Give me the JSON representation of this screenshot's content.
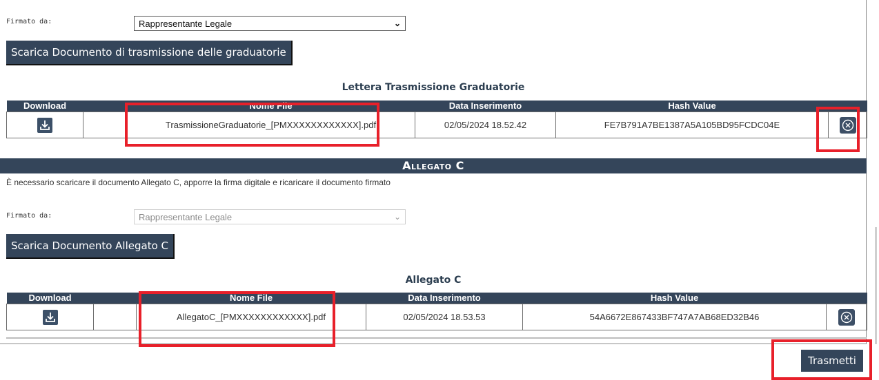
{
  "section1": {
    "signed_by_label": "Firmato da:",
    "signed_by_value": "Rappresentante Legale",
    "download_button": "Scarica Documento di trasmissione delle graduatorie",
    "table_title": "Lettera Trasmissione Graduatorie",
    "headers": [
      "Download",
      "Nome File",
      "Data Inserimento",
      "Hash Value"
    ],
    "row": {
      "file_name": "TrasmissioneGraduatorie_[PMXXXXXXXXXXXX].pdf",
      "date": "02/05/2024 18.52.42",
      "hash": "FE7B791A7BE1387A5A105BD95FCDC04E"
    }
  },
  "section2": {
    "title": "Allegato C",
    "info": "È necessario scaricare il documento Allegato C, apporre la firma digitale e ricaricare il documento firmato",
    "signed_by_label": "Firmato da:",
    "signed_by_value": "Rappresentante Legale",
    "download_button": "Scarica Documento Allegato C",
    "table_title": "Allegato C",
    "headers": [
      "Download",
      "Nome File",
      "Data Inserimento",
      "Hash Value"
    ],
    "row": {
      "file_name": "AllegatoC_[PMXXXXXXXXXXXX].pdf",
      "date": "02/05/2024 18.53.53",
      "hash": "54A6672E867433BF747A7AB68ED32B46"
    }
  },
  "submit_button": "Trasmetti",
  "icons": {
    "download": "download-icon",
    "remove": "remove-circle-x-icon",
    "dropdown": "chevron-down-icon"
  },
  "colors": {
    "header_bg": "#34455a",
    "highlight": "#e8202a"
  }
}
